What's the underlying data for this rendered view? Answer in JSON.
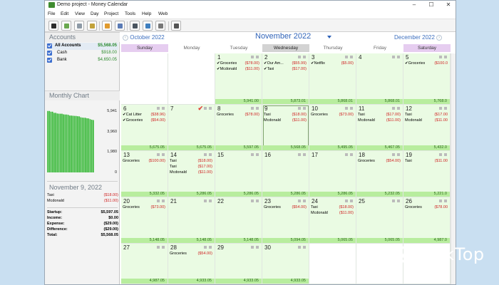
{
  "window": {
    "title": "Demo project - Money Calendar",
    "controls": {
      "minimize": "–",
      "maximize": "☐",
      "close": "✕"
    }
  },
  "menu": [
    "File",
    "Edit",
    "View",
    "Day",
    "Project",
    "Tools",
    "Help",
    "Web"
  ],
  "toolbar": [
    {
      "name": "save-icon",
      "color": "#2b2b2b"
    },
    {
      "name": "new-icon",
      "color": "#6aa84f"
    },
    {
      "name": "edit-icon",
      "color": "#8e9aa6"
    },
    {
      "name": "import-icon",
      "color": "#c2a23a"
    },
    {
      "name": "chart-icon",
      "color": "#e09a2d"
    },
    {
      "name": "table-icon",
      "color": "#5a7bb5"
    },
    {
      "name": "search-icon",
      "color": "#4a5560"
    },
    {
      "name": "download-icon",
      "color": "#3f7fbf"
    },
    {
      "name": "document-icon",
      "color": "#777777"
    },
    {
      "name": "pencil-icon",
      "color": "#555555"
    }
  ],
  "sidebar": {
    "accounts_header": "Accounts",
    "accounts": [
      {
        "name": "All Accounts",
        "value": "$5,568.05",
        "bold": true
      },
      {
        "name": "Cash",
        "value": "$918.00",
        "bold": false
      },
      {
        "name": "Bank",
        "value": "$4,650.05",
        "bold": false
      }
    ],
    "chart_header": "Monthly Chart",
    "day_header": "November 9, 2022",
    "day_items": [
      {
        "desc": "Taxi",
        "amount": "($18.00)"
      },
      {
        "desc": "Mcdonald",
        "amount": "($11.00)"
      }
    ],
    "summary": [
      {
        "label": "Startup:",
        "value": "$5,597.05"
      },
      {
        "label": "Income:",
        "value": "$0.00"
      },
      {
        "label": "Expense:",
        "value": "($29.00)"
      },
      {
        "label": "Difference:",
        "value": "($29.00)"
      },
      {
        "label": "Total:",
        "value": "$5,568.05"
      }
    ]
  },
  "chart_data": {
    "type": "bar",
    "yticks": [
      "5,941",
      "3,960",
      "1,980",
      "0"
    ],
    "ylim": [
      0,
      6200
    ],
    "values": [
      5941,
      5941,
      5870,
      5870,
      5760,
      5760,
      5700,
      5680,
      5675,
      5675,
      5620,
      5600,
      5597,
      5568,
      5500,
      5495,
      5480,
      5467,
      5460,
      5432,
      5420,
      5332,
      5300,
      5286,
      5280,
      5232,
      5221,
      5148,
      5094,
      5065
    ],
    "color": "#2db52d"
  },
  "calendar": {
    "prev_month": "October 2022",
    "month": "November 2022",
    "next_month": "December 2022",
    "weekdays": [
      {
        "label": "Sunday",
        "style": "weekend"
      },
      {
        "label": "Monday",
        "style": ""
      },
      {
        "label": "Tuesday",
        "style": ""
      },
      {
        "label": "Wednesday",
        "style": "today"
      },
      {
        "label": "Thursday",
        "style": ""
      },
      {
        "label": "Friday",
        "style": ""
      },
      {
        "label": "Saturday",
        "style": "weekend"
      }
    ],
    "weeks": [
      [
        null,
        null,
        {
          "day": "1",
          "tx": [
            {
              "d": "✔Groceries",
              "a": "($78.00)"
            },
            {
              "d": "✔Mcdonald",
              "a": "($11.00)"
            }
          ],
          "bal": "5,941.00"
        },
        {
          "day": "2",
          "tx": [
            {
              "d": "✔Our Am...",
              "a": "($55.99)"
            },
            {
              "d": "✔Taxi",
              "a": "($17.00)"
            }
          ],
          "bal": "5,873.01"
        },
        {
          "day": "3",
          "tx": [
            {
              "d": "✔Netflix",
              "a": "($5.00)"
            }
          ],
          "bal": "5,868.01"
        },
        {
          "day": "4",
          "tx": [],
          "bal": "5,868.01"
        },
        {
          "day": "5",
          "tx": [
            {
              "d": "✔Groceries",
              "a": "($100.0"
            }
          ],
          "bal": "5,768.0"
        }
      ],
      [
        {
          "day": "6",
          "tx": [
            {
              "d": "✔Cat Litter",
              "a": "($38.96)"
            },
            {
              "d": "✔Groceries",
              "a": "($54.00)"
            }
          ],
          "bal": "5,675.05"
        },
        {
          "day": "7",
          "tx": [],
          "bal": "5,675.05",
          "check": "✔"
        },
        {
          "day": "8",
          "tx": [
            {
              "d": "Groceries",
              "a": "($78.00)"
            }
          ],
          "bal": "5,597.05"
        },
        {
          "day": "9",
          "tx": [
            {
              "d": "Taxi",
              "a": "($18.00)"
            },
            {
              "d": "Mcdonald",
              "a": "($11.00)"
            }
          ],
          "bal": "5,568.05",
          "today": true
        },
        {
          "day": "10",
          "tx": [
            {
              "d": "Groceries",
              "a": "($73.00)"
            }
          ],
          "bal": "5,495.05"
        },
        {
          "day": "11",
          "tx": [
            {
              "d": "Taxi",
              "a": "($17.00)"
            },
            {
              "d": "Mcdonald",
              "a": "($11.00)"
            }
          ],
          "bal": "5,467.05"
        },
        {
          "day": "12",
          "tx": [
            {
              "d": "Taxi",
              "a": "($17.00"
            },
            {
              "d": "Mcdonald",
              "a": "($11.00"
            }
          ],
          "bal": "5,432.0"
        }
      ],
      [
        {
          "day": "13",
          "tx": [
            {
              "d": "Groceries",
              "a": "($100.00)"
            }
          ],
          "bal": "5,332.05"
        },
        {
          "day": "14",
          "tx": [
            {
              "d": "Taxi",
              "a": "($18.00)"
            },
            {
              "d": "Taxi",
              "a": "($17.00)"
            },
            {
              "d": "Mcdonald",
              "a": "($11.00)"
            }
          ],
          "bal": "5,286.05"
        },
        {
          "day": "15",
          "tx": [],
          "bal": "5,286.05"
        },
        {
          "day": "16",
          "tx": [],
          "bal": "5,286.05"
        },
        {
          "day": "17",
          "tx": [],
          "bal": "5,286.05"
        },
        {
          "day": "18",
          "tx": [
            {
              "d": "Groceries",
              "a": "($54.00)"
            }
          ],
          "bal": "5,232.05"
        },
        {
          "day": "19",
          "tx": [
            {
              "d": "Taxi",
              "a": "($11.00"
            }
          ],
          "bal": "5,221.0"
        }
      ],
      [
        {
          "day": "20",
          "tx": [
            {
              "d": "Groceries",
              "a": "($73.00)"
            }
          ],
          "bal": "5,148.05"
        },
        {
          "day": "21",
          "tx": [],
          "bal": "5,148.05"
        },
        {
          "day": "22",
          "tx": [],
          "bal": "5,148.05"
        },
        {
          "day": "23",
          "tx": [
            {
              "d": "Groceries",
              "a": "($54.00)"
            }
          ],
          "bal": "5,094.05"
        },
        {
          "day": "24",
          "tx": [
            {
              "d": "Taxi",
              "a": "($18.00)"
            },
            {
              "d": "Mcdonald",
              "a": "($11.00)"
            }
          ],
          "bal": "5,065.05"
        },
        {
          "day": "25",
          "tx": [],
          "bal": "5,065.05"
        },
        {
          "day": "26",
          "tx": [
            {
              "d": "Groceries",
              "a": "($78.00"
            }
          ],
          "bal": "4,987.0"
        }
      ],
      [
        {
          "day": "27",
          "tx": [],
          "bal": "4,987.05"
        },
        {
          "day": "28",
          "tx": [
            {
              "d": "Groceries",
              "a": "($54.00)"
            }
          ],
          "bal": "4,933.05"
        },
        {
          "day": "29",
          "tx": [],
          "bal": "4,933.05"
        },
        {
          "day": "30",
          "tx": [],
          "bal": "4,933.05"
        },
        null,
        null,
        null
      ]
    ]
  },
  "watermark": {
    "text": "DeskTop"
  }
}
